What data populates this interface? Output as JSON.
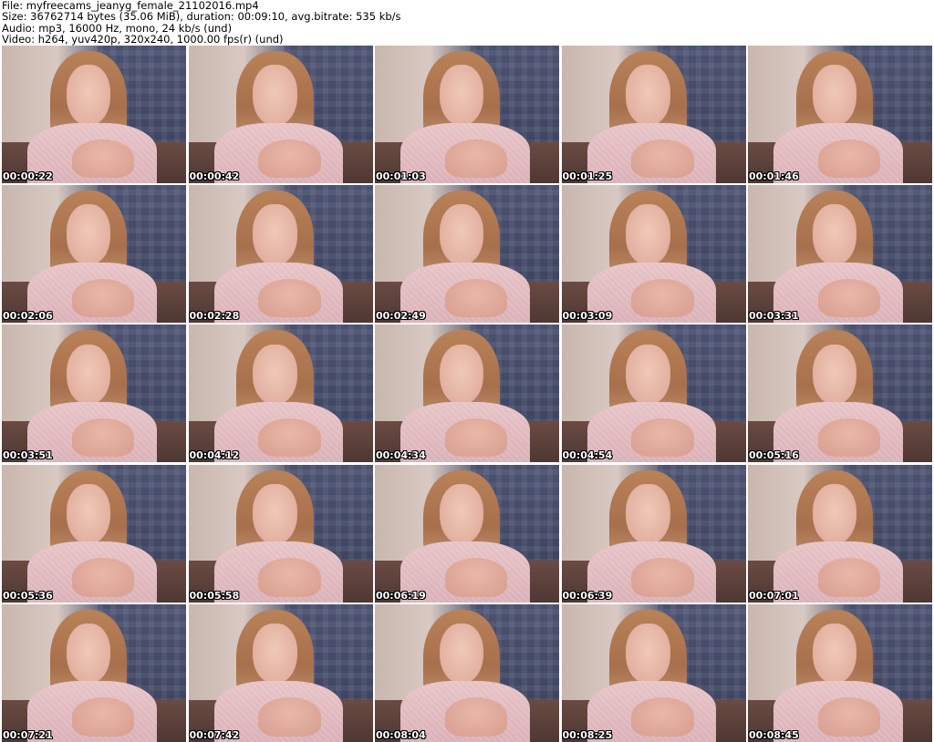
{
  "header": {
    "file": "File: myfreecams_jeanyg_female_21102016.mp4",
    "size": "Size: 36762714 bytes (35.06 MiB), duration: 00:09:10, avg.bitrate: 535 kb/s",
    "audio": "Audio: mp3, 16000 Hz, mono, 24 kb/s (und)",
    "video": "Video: h264, yuv420p, 320x240, 1000.00 fps(r) (und)"
  },
  "thumbnails": [
    {
      "timestamp": "00:00:22"
    },
    {
      "timestamp": "00:00:42"
    },
    {
      "timestamp": "00:01:03"
    },
    {
      "timestamp": "00:01:25"
    },
    {
      "timestamp": "00:01:46"
    },
    {
      "timestamp": "00:02:06"
    },
    {
      "timestamp": "00:02:28"
    },
    {
      "timestamp": "00:02:49"
    },
    {
      "timestamp": "00:03:09"
    },
    {
      "timestamp": "00:03:31"
    },
    {
      "timestamp": "00:03:51"
    },
    {
      "timestamp": "00:04:12"
    },
    {
      "timestamp": "00:04:34"
    },
    {
      "timestamp": "00:04:54"
    },
    {
      "timestamp": "00:05:16"
    },
    {
      "timestamp": "00:05:36"
    },
    {
      "timestamp": "00:05:58"
    },
    {
      "timestamp": "00:06:19"
    },
    {
      "timestamp": "00:06:39"
    },
    {
      "timestamp": "00:07:01"
    },
    {
      "timestamp": "00:07:21"
    },
    {
      "timestamp": "00:07:42"
    },
    {
      "timestamp": "00:08:04"
    },
    {
      "timestamp": "00:08:25"
    },
    {
      "timestamp": "00:08:45"
    }
  ]
}
